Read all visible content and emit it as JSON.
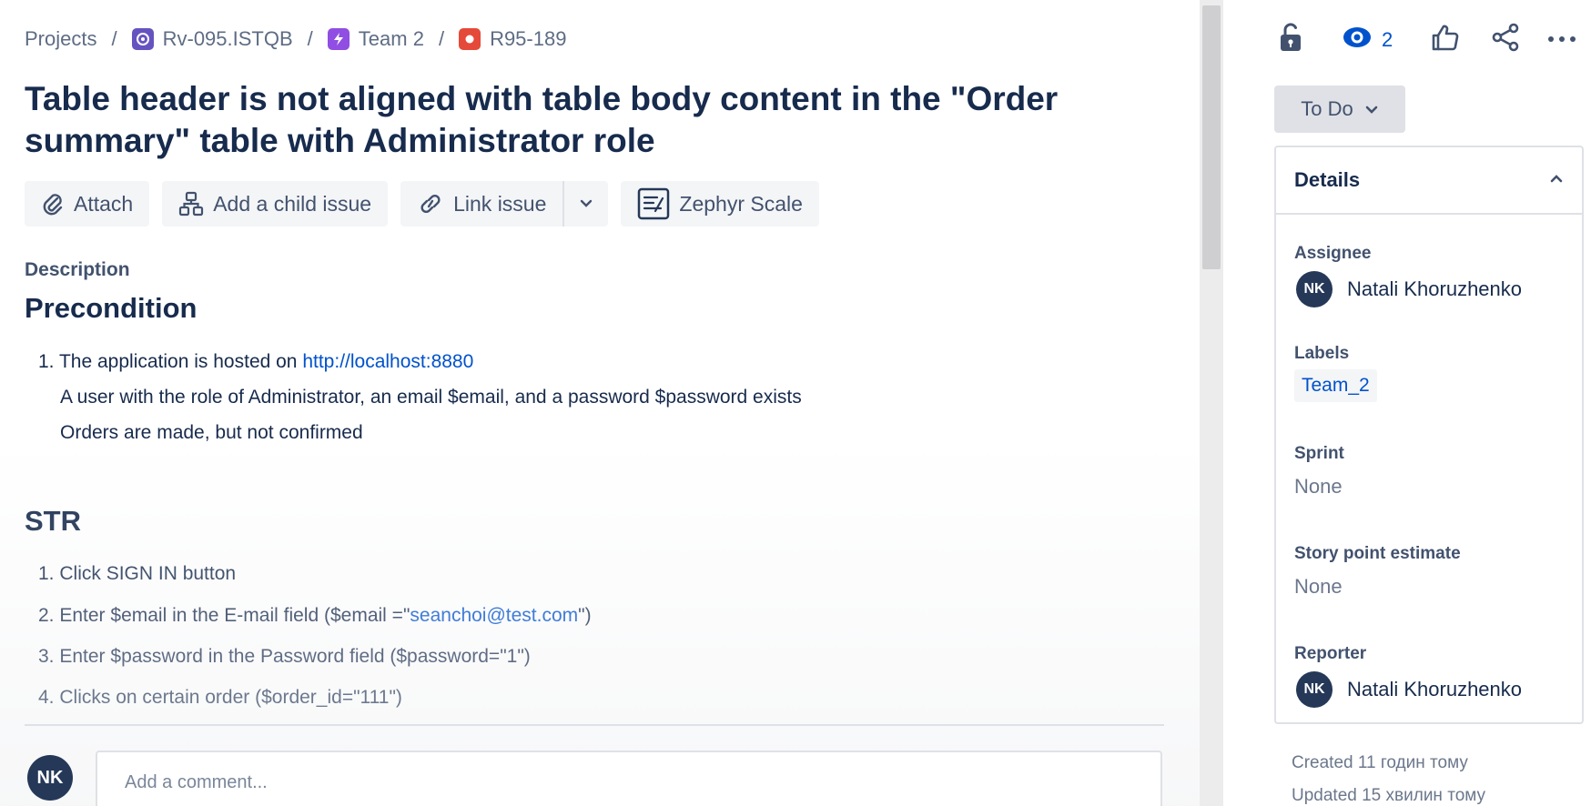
{
  "breadcrumb": {
    "root": "Projects",
    "project": "Rv-095.ISTQB",
    "epic": "Team 2",
    "issue_key": "R95-189",
    "separator": "/"
  },
  "issue": {
    "title": "Table header is not aligned with table body content in the \"Order summary\" table with Administrator role"
  },
  "toolbar": {
    "attach": "Attach",
    "add_child": "Add a child issue",
    "link_issue": "Link issue",
    "zephyr": "Zephyr Scale"
  },
  "description": {
    "label": "Description",
    "precondition_heading": "Precondition",
    "precondition_num": "1.",
    "precondition_text": "The application is hosted on ",
    "precondition_link": "http://localhost:8880",
    "precondition_line2": "A user with the role of Administrator, an email $email, and a password $password exists",
    "precondition_line3": "Orders are made, but not confirmed",
    "str_heading": "STR",
    "steps": [
      {
        "num": "1.",
        "text": "Click SIGN IN button"
      },
      {
        "num": "2.",
        "text": "Enter $email in the E-mail field ($email =\"",
        "link": "seanchoi@test.com",
        "tail": "\")"
      },
      {
        "num": "3.",
        "text": "Enter $password in the Password field ($password=\"1\")"
      },
      {
        "num": "4.",
        "text": "Clicks on certain order ($order_id=\"111\")"
      }
    ]
  },
  "comment": {
    "avatar": "NK",
    "placeholder": "Add a comment..."
  },
  "actions": {
    "watch_count": "2",
    "icons": [
      "unlock-icon",
      "eye-icon",
      "like-icon",
      "share-icon",
      "more-icon"
    ]
  },
  "status": {
    "label": "To Do"
  },
  "details": {
    "title": "Details",
    "assignee_label": "Assignee",
    "assignee_initials": "NK",
    "assignee_name": "Natali Khoruzhenko",
    "labels_label": "Labels",
    "label_value": "Team_2",
    "sprint_label": "Sprint",
    "sprint_value": "None",
    "story_points_label": "Story point estimate",
    "story_points_value": "None",
    "reporter_label": "Reporter",
    "reporter_initials": "NK",
    "reporter_name": "Natali Khoruzhenko"
  },
  "meta": {
    "created": "Created 11 годин тому",
    "updated": "Updated 15 хвилин тому"
  },
  "colors": {
    "accent": "#0052cc",
    "text": "#172b4d",
    "muted": "#6b778c",
    "avatar_bg": "#253858",
    "bug_red": "#e5493a",
    "epic_purple": "#904ee2"
  }
}
